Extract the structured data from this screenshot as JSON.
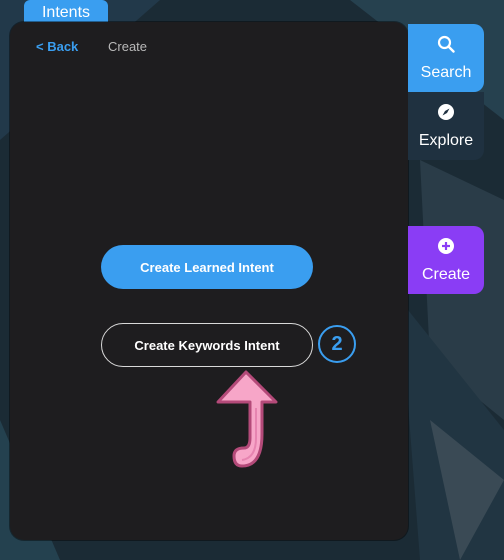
{
  "tabs": {
    "intents": "Intents"
  },
  "breadcrumb": {
    "back": "< Back",
    "current": "Create"
  },
  "side_nav": {
    "search": "Search",
    "explore": "Explore",
    "create": "Create"
  },
  "buttons": {
    "learned": "Create Learned Intent",
    "keywords": "Create Keywords Intent"
  },
  "annotation": {
    "step": "2"
  },
  "icons": {
    "search": "search-icon",
    "explore": "compass-icon",
    "create": "plus-circle-icon",
    "pointer": "up-arrow-icon"
  },
  "colors": {
    "accent": "#3a9ef0",
    "create_accent": "#8a3df5",
    "panel": "#1e1d1f",
    "arrow": "#f7a6c8"
  }
}
